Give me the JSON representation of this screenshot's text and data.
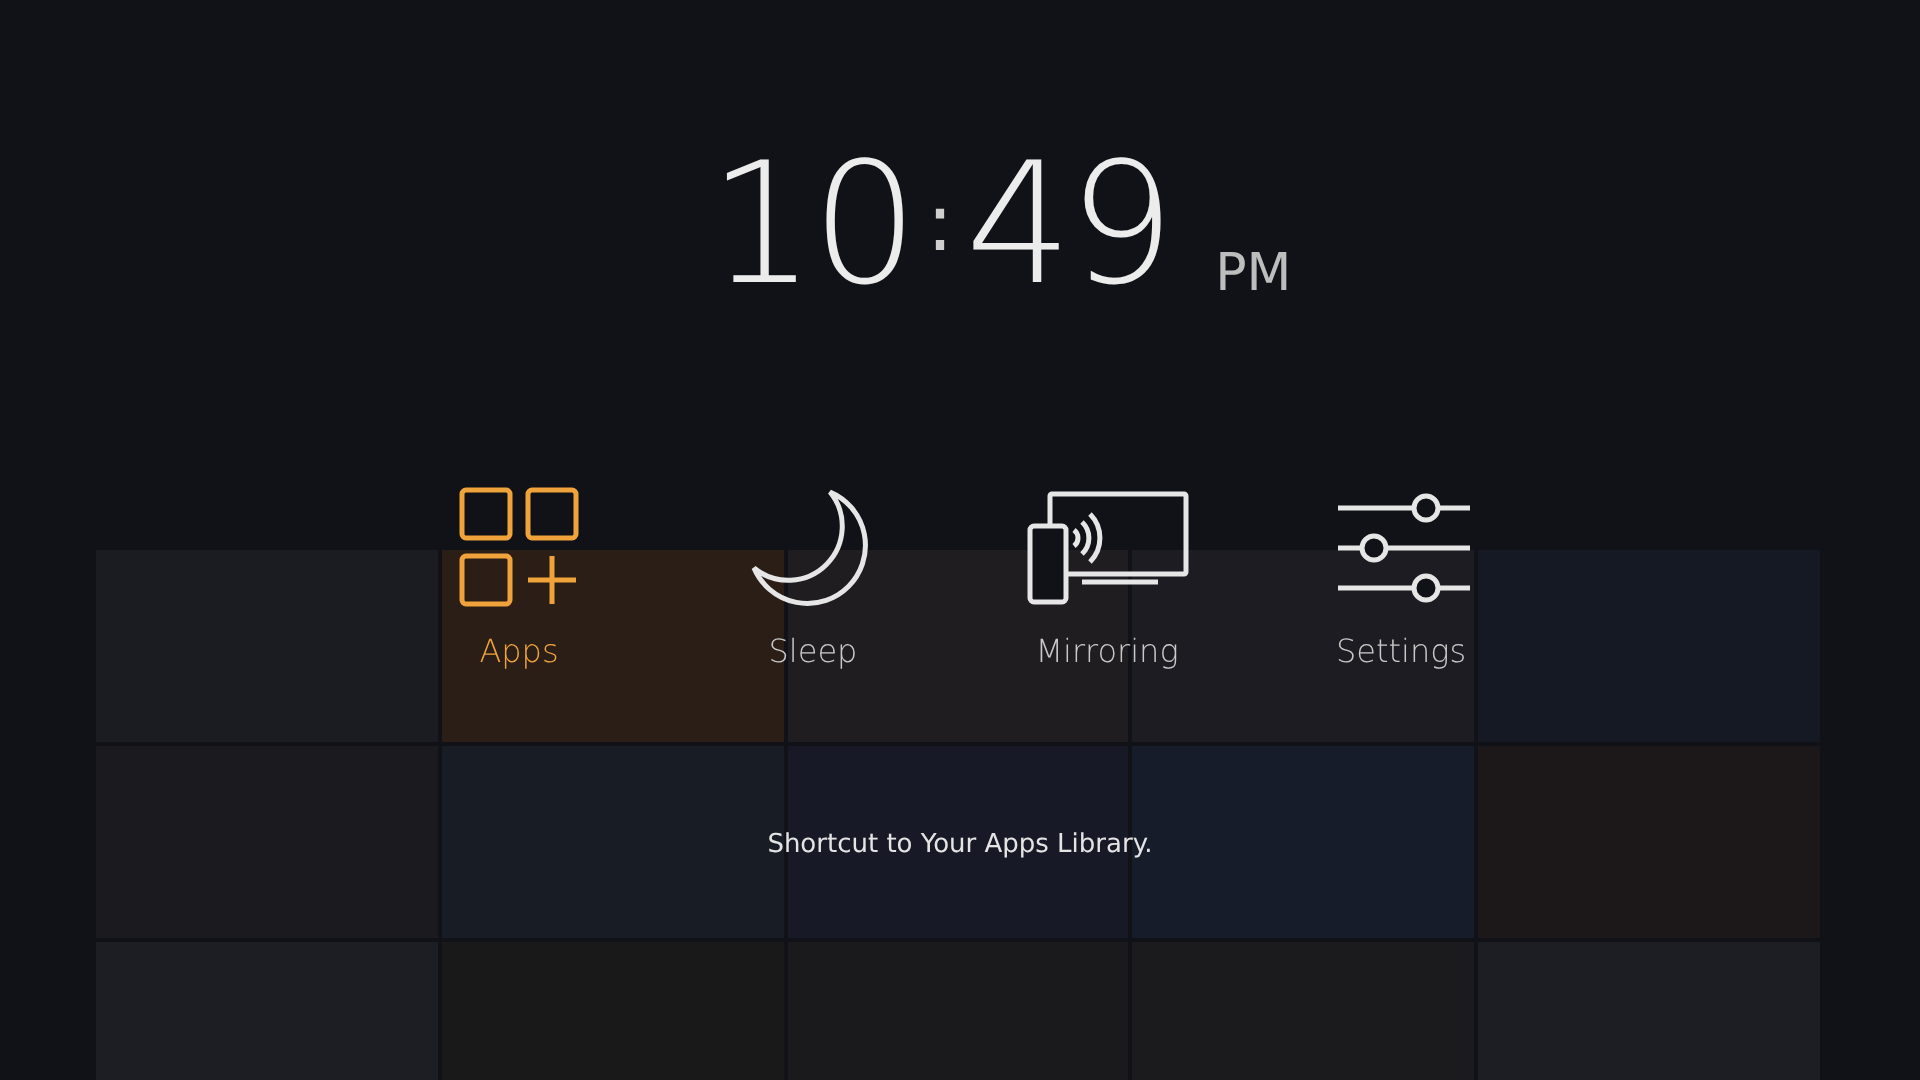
{
  "clock": {
    "hours": "10",
    "separator": ":",
    "minutes": "49",
    "meridiem": "PM"
  },
  "menu": [
    {
      "label": "Apps",
      "kind": "apps",
      "selected": true
    },
    {
      "label": "Sleep",
      "kind": "sleep",
      "selected": false
    },
    {
      "label": "Mirroring",
      "kind": "mirroring",
      "selected": false
    },
    {
      "label": "Settings",
      "kind": "settings",
      "selected": false
    }
  ],
  "description": "Shortcut to Your Apps Library."
}
